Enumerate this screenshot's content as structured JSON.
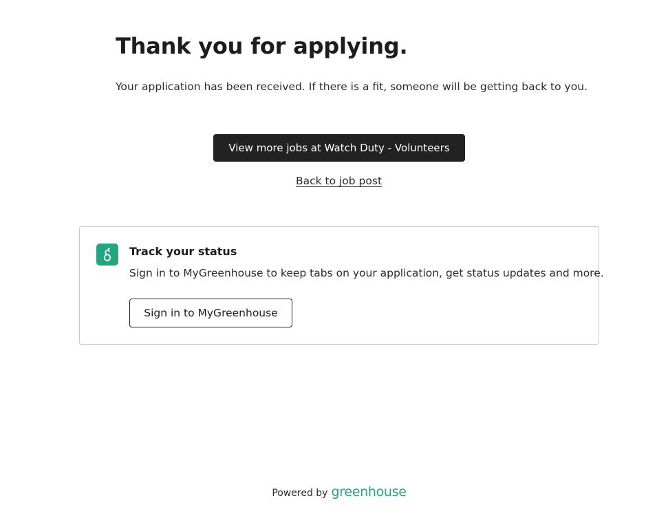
{
  "confirmation": {
    "heading": "Thank you for applying.",
    "message": "Your application has been received. If there is a fit, someone will be getting back to you.",
    "view_jobs_label": "View more jobs at Watch Duty - Volunteers",
    "back_link_label": "Back to job post"
  },
  "track_status": {
    "icon": "greenhouse-logo-icon",
    "title": "Track your status",
    "description": "Sign in to MyGreenhouse to keep tabs on your application, get status updates and more.",
    "signin_label": "Sign in to MyGreenhouse"
  },
  "footer": {
    "powered_by": "Powered by",
    "brand": "greenhouse"
  },
  "colors": {
    "brand_green": "#24a47f",
    "primary_button": "#222222",
    "text": "#1d1d1d"
  }
}
